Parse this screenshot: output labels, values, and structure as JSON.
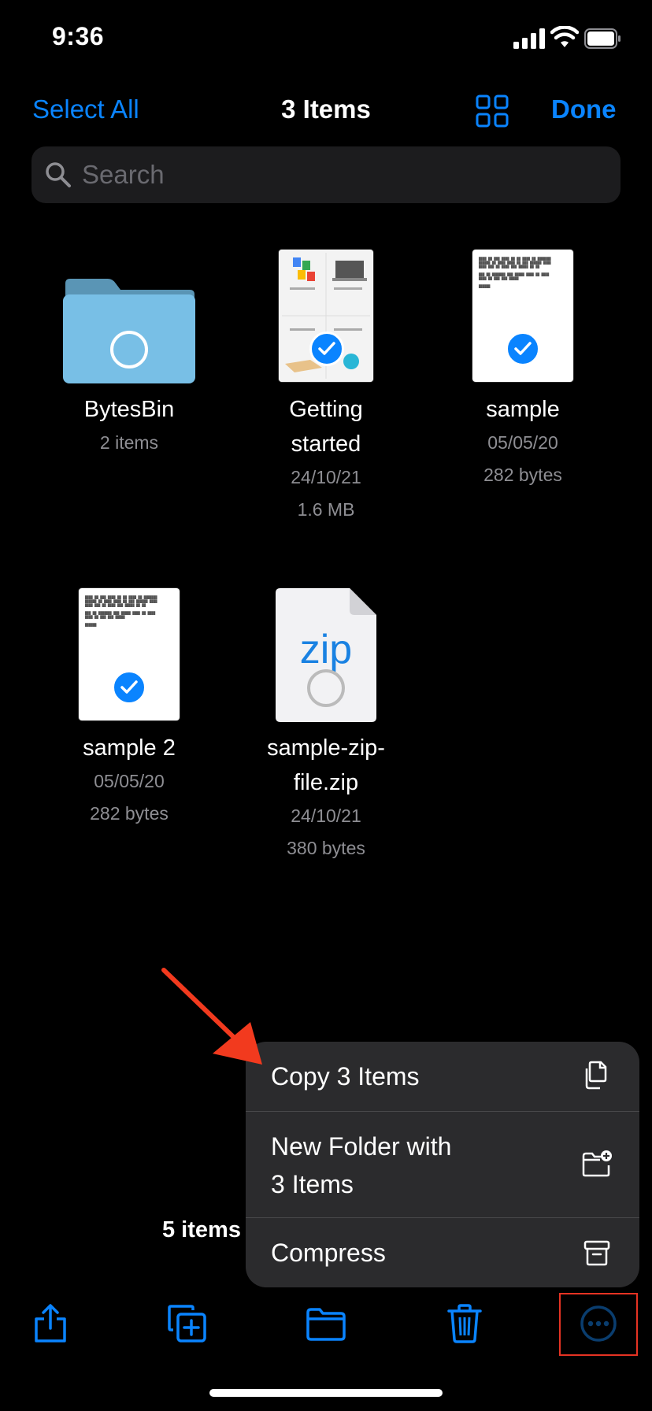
{
  "status_bar": {
    "time": "9:36"
  },
  "nav": {
    "select_all": "Select All",
    "title": "3 Items",
    "done": "Done"
  },
  "search": {
    "placeholder": "Search"
  },
  "items": [
    {
      "name": "BytesBin",
      "meta1": "2 items",
      "meta2": "",
      "selected": false,
      "icon": "folder-icon"
    },
    {
      "name_line1": "Getting",
      "name_line2": "started",
      "meta1": "24/10/21",
      "meta2": "1.6 MB",
      "selected": true,
      "icon": "document-thumbnail"
    },
    {
      "name": "sample",
      "meta1": "05/05/20",
      "meta2": "282 bytes",
      "selected": true,
      "icon": "document-thumbnail"
    },
    {
      "name": "sample 2",
      "meta1": "05/05/20",
      "meta2": "282 bytes",
      "selected": true,
      "icon": "document-thumbnail"
    },
    {
      "name_line1": "sample-zip-",
      "name_line2": "file.zip",
      "meta1": "24/10/21",
      "meta2": "380 bytes",
      "selected": false,
      "icon": "zip-file-icon",
      "zip_label": "zip"
    }
  ],
  "footer": {
    "count": "5 items"
  },
  "menu": {
    "copy": "Copy 3 Items",
    "new_folder_line1": "New Folder with",
    "new_folder_line2": "3 Items",
    "compress": "Compress"
  },
  "toolbar": [
    "share-icon",
    "duplicate-icon",
    "move-folder-icon",
    "trash-icon",
    "more-icon"
  ],
  "colors": {
    "accent": "#0a84ff",
    "background": "#000000",
    "menu_bg": "#2b2b2d",
    "annotation": "#e53323",
    "folder": "#7cc4ea"
  }
}
